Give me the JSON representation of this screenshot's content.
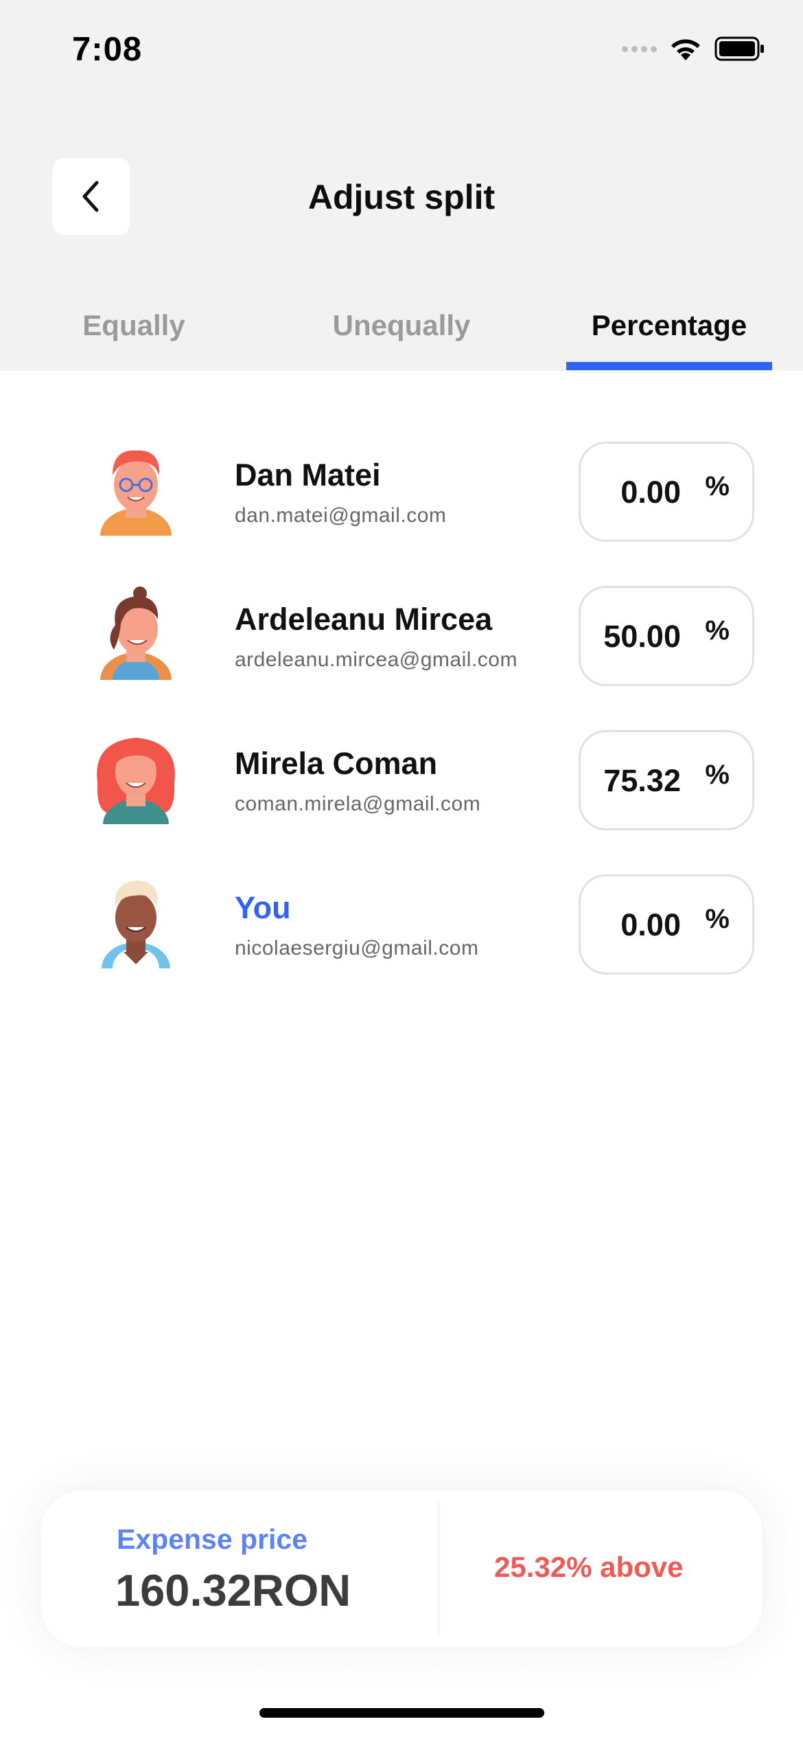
{
  "status_bar": {
    "time": "7:08"
  },
  "header": {
    "title": "Adjust split",
    "back_icon": "chevron-left-icon"
  },
  "tabs": [
    {
      "label": "Equally",
      "active": false
    },
    {
      "label": "Unequally",
      "active": false
    },
    {
      "label": "Percentage",
      "active": true
    }
  ],
  "people": [
    {
      "name": "Dan Matei",
      "email": "dan.matei@gmail.com",
      "percentage": "0.00",
      "percent_symbol": "%",
      "avatar": "avatar-man-glasses-icon",
      "is_you": false
    },
    {
      "name": "Ardeleanu Mircea",
      "email": "ardeleanu.mircea@gmail.com",
      "percentage": "50.00",
      "percent_symbol": "%",
      "avatar": "avatar-woman-brown-hair-icon",
      "is_you": false
    },
    {
      "name": "Mirela Coman",
      "email": "coman.mirela@gmail.com",
      "percentage": "75.32",
      "percent_symbol": "%",
      "avatar": "avatar-woman-red-hair-icon",
      "is_you": false
    },
    {
      "name": "You",
      "email": "nicolaesergiu@gmail.com",
      "percentage": "0.00",
      "percent_symbol": "%",
      "avatar": "avatar-man-blond-hair-icon",
      "is_you": true
    }
  ],
  "summary": {
    "label": "Expense price",
    "value": "160.32RON",
    "status": "25.32% above"
  },
  "colors": {
    "accent": "#2f63f3",
    "label_blue": "#5b84f2",
    "warning": "#ef5a55",
    "top_background": "#f2f2f3"
  }
}
